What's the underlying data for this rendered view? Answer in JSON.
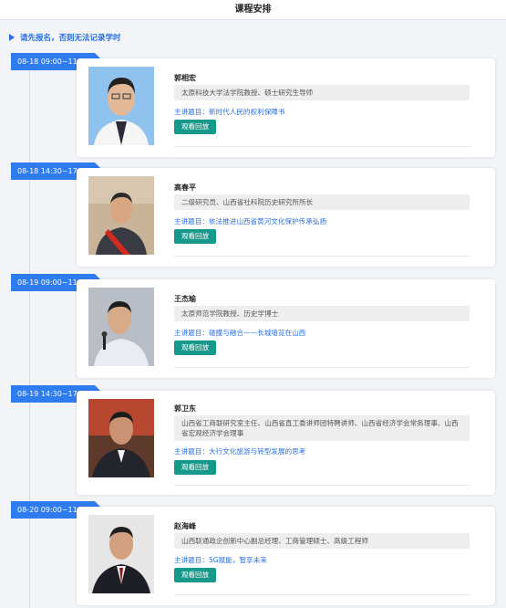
{
  "header": {
    "title": "课程安排"
  },
  "notice": {
    "text": "请先报名，否则无法记录学时"
  },
  "sessions": [
    {
      "time": "08-18 09:00~11:30",
      "name": "郭相宏",
      "title": "太原科技大学法学院教授、硕士研究生导师",
      "topic": "主讲题目：新时代人民的权利保障书",
      "button": "观看回放"
    },
    {
      "time": "08-18 14:30~17:00",
      "name": "高春平",
      "title": "二级研究员、山西省社科院历史研究所所长",
      "topic": "主讲题目：依法推进山西省黄河文化保护传承弘扬",
      "button": "观看回放"
    },
    {
      "time": "08-19 09:00~11:30",
      "name": "王杰瑜",
      "title": "太原师范学院教授、历史学博士",
      "topic": "主讲题目：碰撞与融合——长城墙览在山西",
      "button": "观看回放"
    },
    {
      "time": "08-19 14:30~17:00",
      "name": "郭卫东",
      "title": "山西省工商联研究室主任、山西省直工委讲师团特聘讲师、山西省经济学会常务理事、山西省宏观经济学会理事",
      "topic": "主讲题目：大行文化旅游与转型发展的思考",
      "button": "观看回放"
    },
    {
      "time": "08-20 09:00~11:30",
      "name": "赵海峰",
      "title": "山西联通政企创新中心副总经理、工商管理硕士、高级工程师",
      "topic": "主讲题目：5G赋能，智享未来",
      "button": "观看回放"
    }
  ]
}
